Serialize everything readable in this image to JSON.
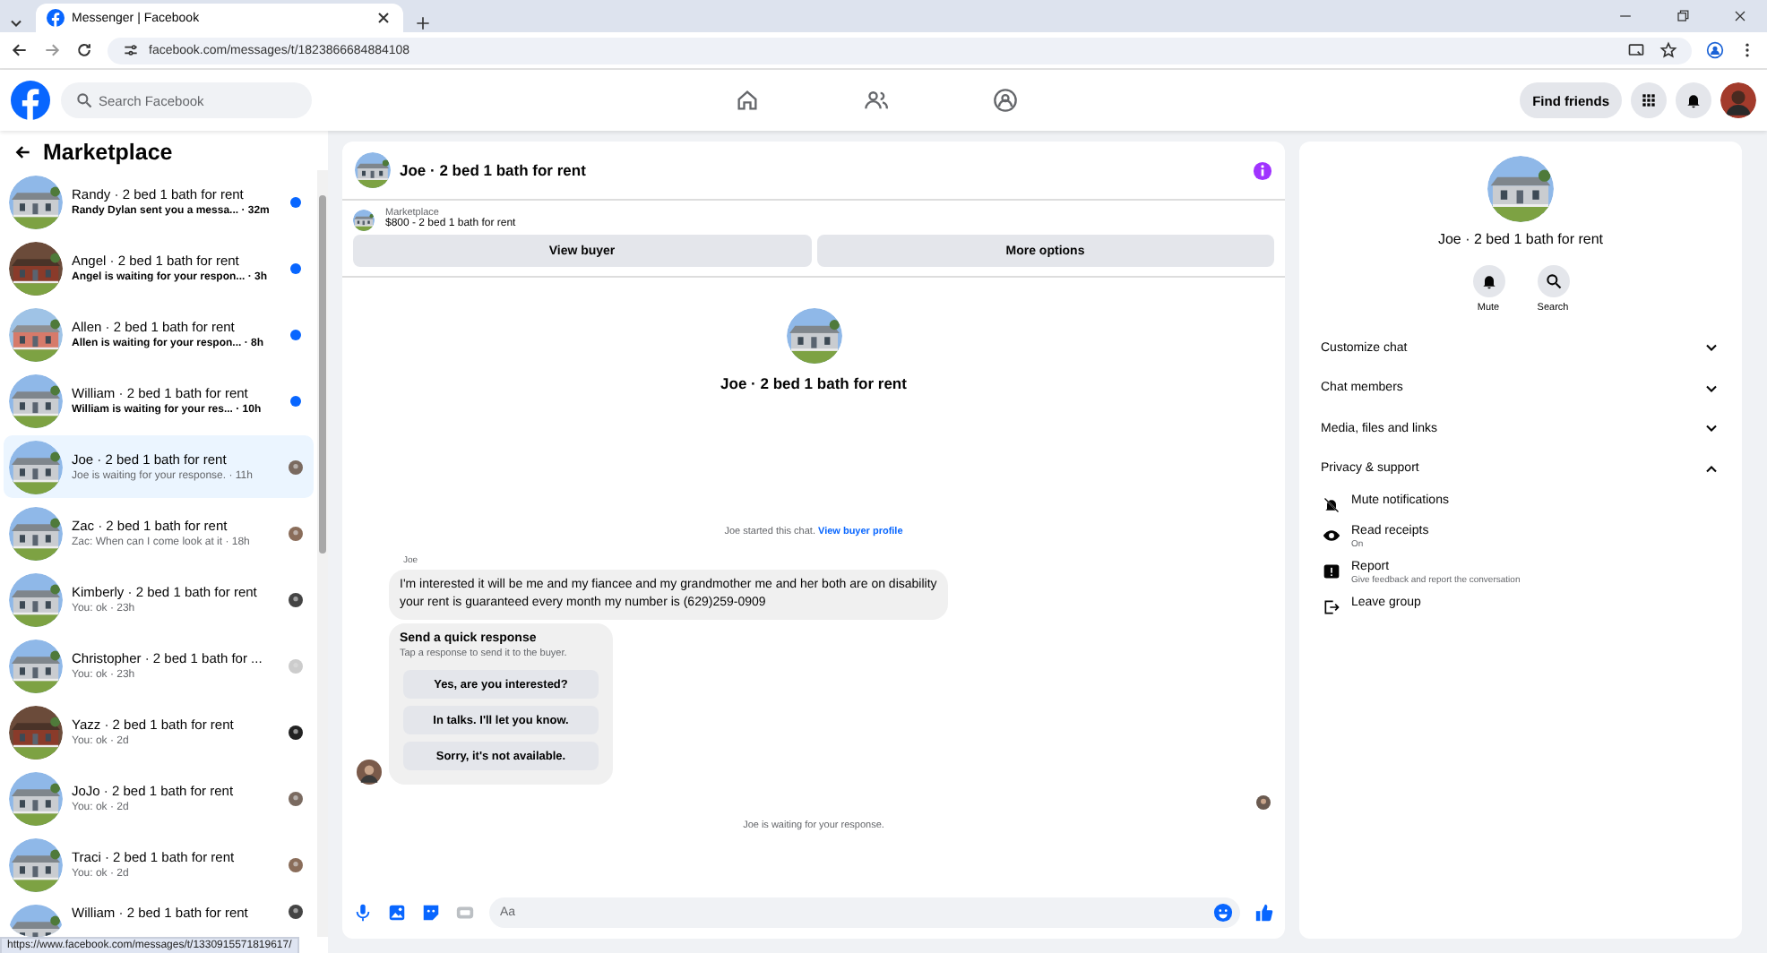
{
  "browser": {
    "tab_title": "Messenger | Facebook",
    "url": "facebook.com/messages/t/1823866684884108"
  },
  "header": {
    "search": {
      "placeholder": "Search Facebook"
    },
    "find_friends": "Find friends"
  },
  "sidebar": {
    "title": "Marketplace",
    "conversations": [
      {
        "title": "Randy · 2 bed 1 bath for rent",
        "preview": "Randy Dylan sent you a messa... · 32m",
        "unread": true,
        "selected": false
      },
      {
        "title": "Angel · 2 bed 1 bath for rent",
        "preview": "Angel is waiting for your respon... · 3h",
        "unread": true,
        "selected": false
      },
      {
        "title": "Allen · 2 bed 1 bath for rent",
        "preview": "Allen is waiting for your respon... · 8h",
        "unread": true,
        "selected": false
      },
      {
        "title": "William · 2 bed 1 bath for rent",
        "preview": "William is waiting for your res... · 10h",
        "unread": true,
        "selected": false
      },
      {
        "title": "Joe · 2 bed 1 bath for rent",
        "preview": "Joe is waiting for your response. · 11h",
        "unread": false,
        "selected": true
      },
      {
        "title": "Zac · 2 bed 1 bath for rent",
        "preview": "Zac: When can I come look at it · 18h",
        "unread": false,
        "selected": false
      },
      {
        "title": "Kimberly · 2 bed 1 bath for rent",
        "preview": "You: ok · 23h",
        "unread": false,
        "selected": false
      },
      {
        "title": "Christopher · 2 bed 1 bath for ...",
        "preview": "You: ok · 23h",
        "unread": false,
        "selected": false
      },
      {
        "title": "Yazz · 2 bed 1 bath for rent",
        "preview": "You: ok · 2d",
        "unread": false,
        "selected": false
      },
      {
        "title": "JoJo · 2 bed 1 bath for rent",
        "preview": "You: ok · 2d",
        "unread": false,
        "selected": false
      },
      {
        "title": "Traci · 2 bed 1 bath for rent",
        "preview": "You: ok · 2d",
        "unread": false,
        "selected": false
      },
      {
        "title": "William · 2 bed 1 bath for rent",
        "unread": false,
        "selected": false
      }
    ]
  },
  "chat": {
    "title": "Joe · 2 bed 1 bath for rent",
    "listing": {
      "label": "Marketplace",
      "price": "$800 - 2 bed 1 bath for rent"
    },
    "buttons": [
      "View buyer",
      "More options"
    ],
    "intro_name": "Joe · 2 bed 1 bath for rent",
    "started": "Joe started this chat.",
    "profile_link": "View buyer profile",
    "sender": "Joe",
    "message": "I'm interested it will be me and my fiancee and my grandmother me and her both are on disability your rent is guaranteed every month my number is (629)259-0909",
    "quick_response": {
      "title": "Send a quick response",
      "hint": "Tap a response to send it to the buyer.",
      "options": [
        "Yes, are you interested?",
        "In talks. I'll let you know.",
        "Sorry, it's not available."
      ]
    },
    "waiting": "Joe is waiting for your response.",
    "composer": {
      "placeholder": "Aa"
    }
  },
  "details": {
    "name": "Joe · 2 bed 1 bath for rent",
    "actions": [
      {
        "kind": "bell",
        "label": "Mute"
      },
      {
        "kind": "search",
        "label": "Search"
      }
    ],
    "sections": [
      {
        "label": "Customize chat",
        "expanded": false
      },
      {
        "label": "Chat members",
        "expanded": false
      },
      {
        "label": "Media, files and links",
        "expanded": false
      },
      {
        "label": "Privacy & support",
        "expanded": true
      }
    ],
    "privacy_items": [
      {
        "kind": "mute",
        "label": "Mute notifications"
      },
      {
        "kind": "eye",
        "label": "Read receipts",
        "subtitle": "On"
      },
      {
        "kind": "report",
        "label": "Report",
        "subtitle": "Give feedback and report the conversation"
      },
      {
        "kind": "leave",
        "label": "Leave group"
      }
    ]
  },
  "status_url": "https://www.facebook.com/messages/t/1330915571819617/"
}
